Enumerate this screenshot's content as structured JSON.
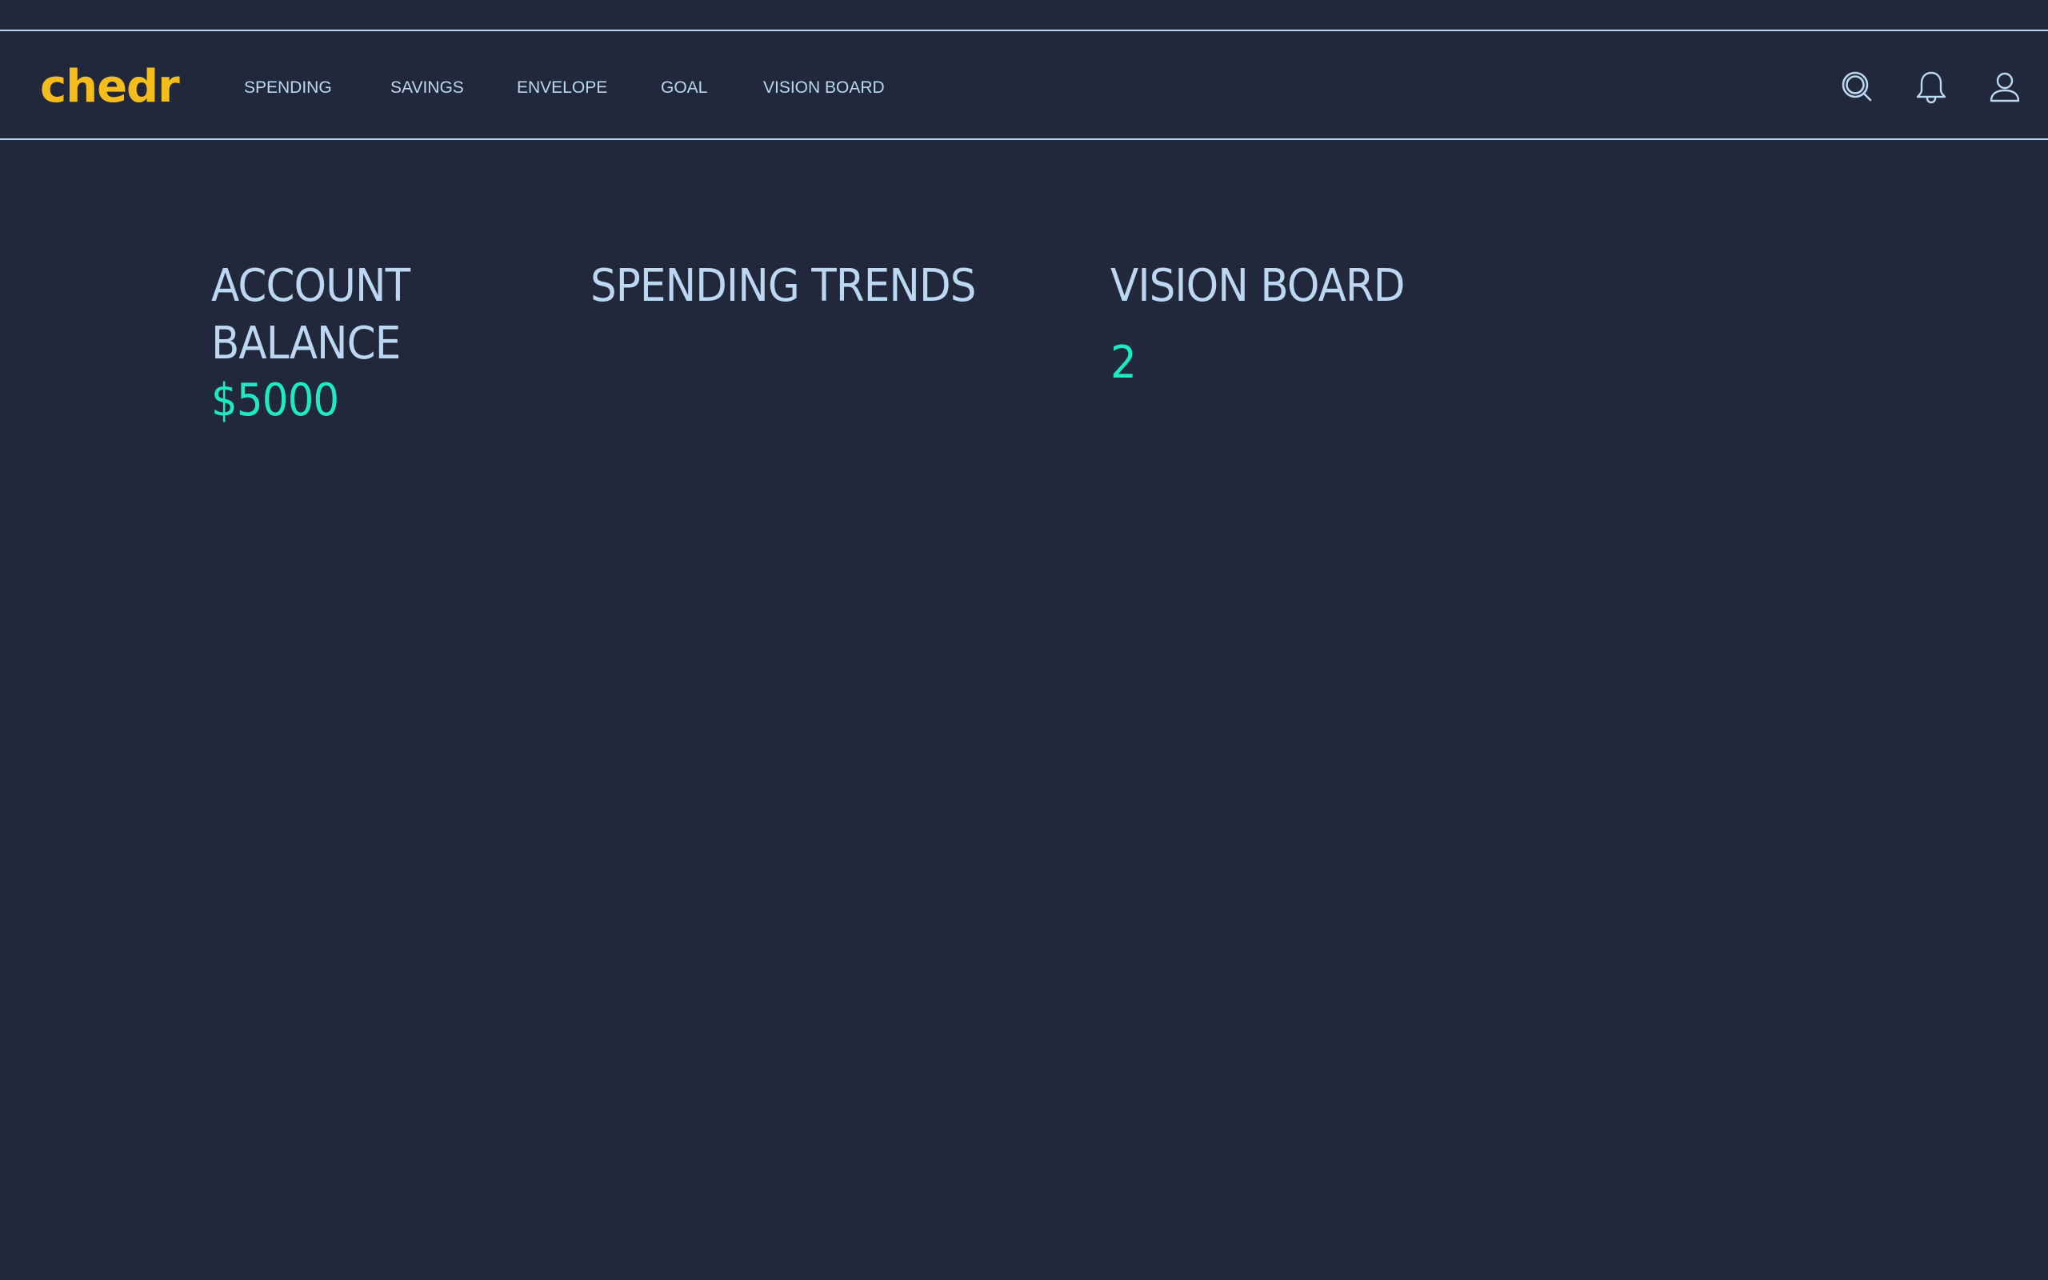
{
  "brand": {
    "name": "chedr",
    "color": "#f5bd1c"
  },
  "nav": {
    "items": [
      {
        "label": "SPENDING"
      },
      {
        "label": "SAVINGS"
      },
      {
        "label": "ENVELOPE"
      },
      {
        "label": "GOAL"
      },
      {
        "label": "VISION BOARD"
      }
    ],
    "icons": [
      "search-icon",
      "bell-icon",
      "user-icon"
    ]
  },
  "dashboard": {
    "account_balance": {
      "title_line1": "ACCOUNT",
      "title_line2": "BALANCE",
      "value": "$5000"
    },
    "spending_trends": {
      "title": "SPENDING TRENDS"
    },
    "vision_board": {
      "title": "VISION BOARD",
      "value": "2"
    }
  },
  "colors": {
    "background": "#22283b",
    "text": "#bcd7f2",
    "accent_value": "#1de9c3",
    "divider": "#b9d6f3"
  }
}
